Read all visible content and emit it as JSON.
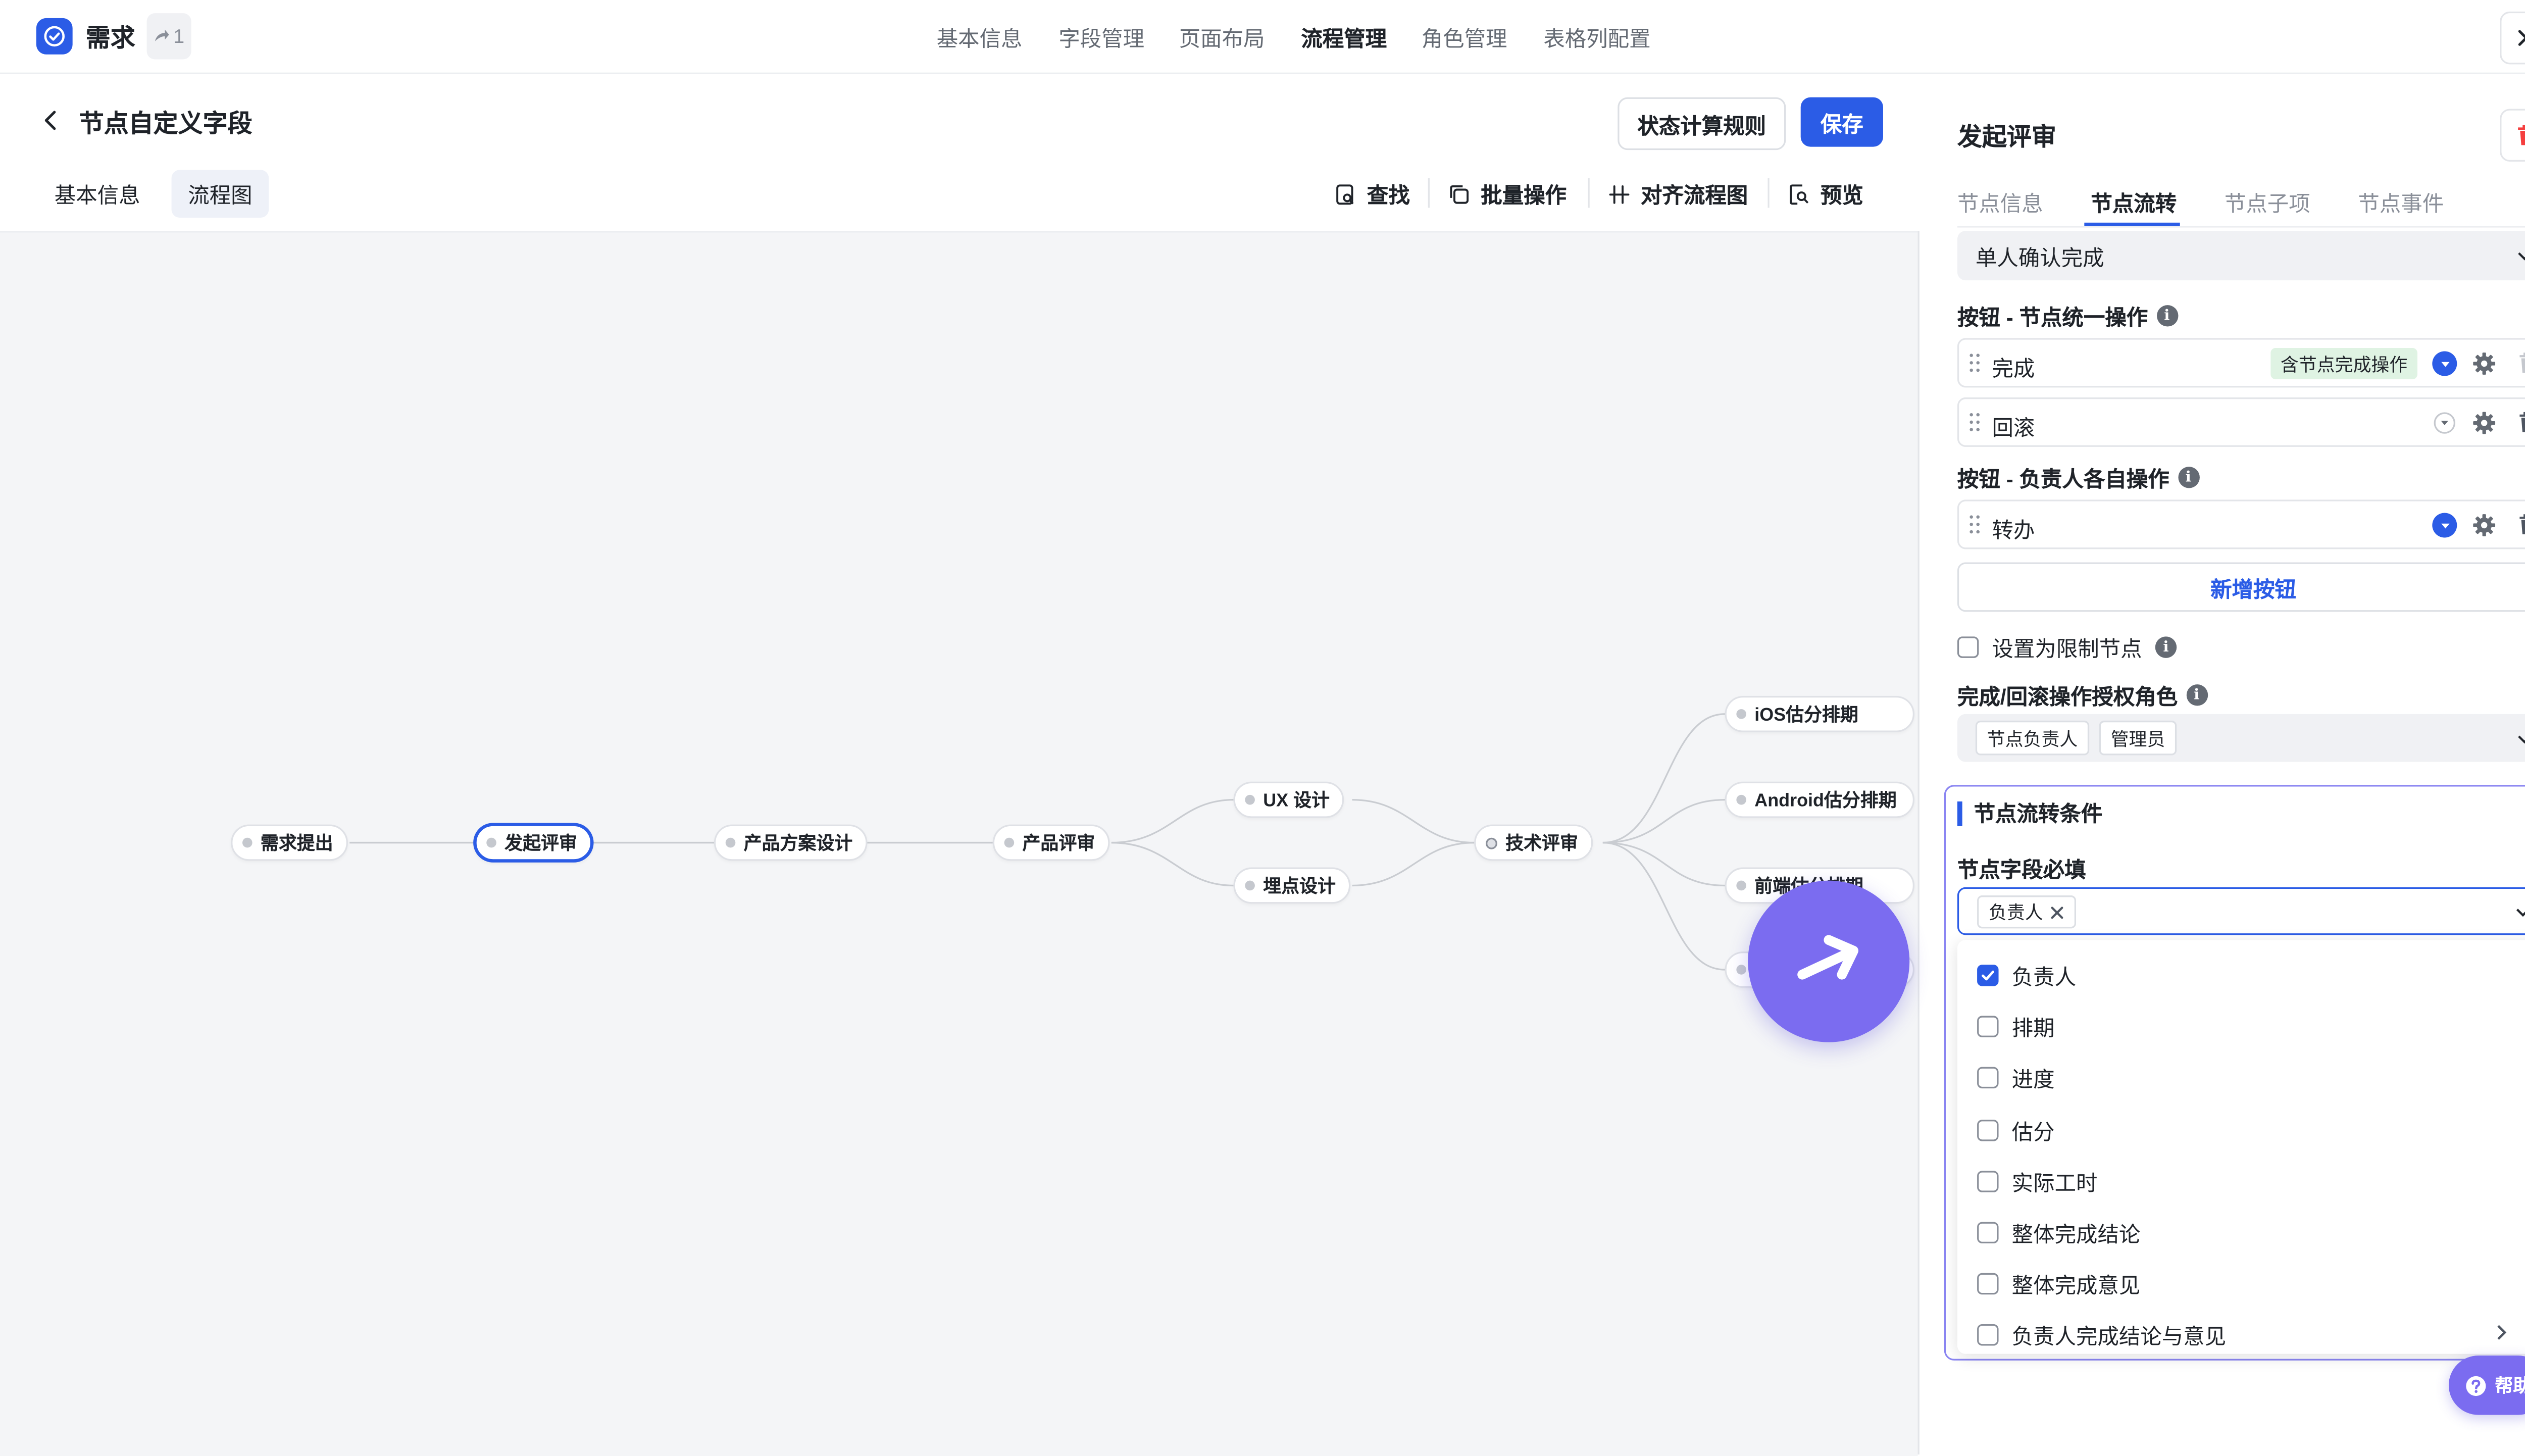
{
  "app": {
    "title": "需求",
    "badge_count": "1"
  },
  "nav": [
    "基本信息",
    "字段管理",
    "页面布局",
    "流程管理",
    "角色管理",
    "表格列配置"
  ],
  "nav_active": "流程管理",
  "page": {
    "title": "节点自定义字段",
    "btn_rule": "状态计算规则",
    "btn_save": "保存",
    "subtabs": [
      "基本信息",
      "流程图"
    ],
    "tools": {
      "find": "查找",
      "batch": "批量操作",
      "align": "对齐流程图",
      "preview": "预览"
    }
  },
  "flow": {
    "nodes": {
      "n1": "需求提出",
      "n2": "发起评审",
      "n3": "产品方案设计",
      "n4": "产品评审",
      "n5": "UX 设计",
      "n6": "埋点设计",
      "n7": "技术评审",
      "n8": "iOS估分排期",
      "n9": "Android估分排期",
      "n10": "前端估分排期"
    }
  },
  "panel": {
    "title": "发起评审",
    "tabs": [
      "节点信息",
      "节点流转",
      "节点子项",
      "节点事件"
    ],
    "complete_mode": "单人确认完成",
    "sec_unified": "按钮 - 节点统一操作",
    "buttons_unified": [
      {
        "label": "完成",
        "tag": "含节点完成操作"
      },
      {
        "label": "回滚"
      }
    ],
    "sec_individual": "按钮 - 负责人各自操作",
    "buttons_individual": [
      {
        "label": "转办"
      }
    ],
    "add_button": "新增按钮",
    "restrict_label": "设置为限制节点",
    "roles_label": "完成/回滚操作授权角色",
    "roles": [
      "节点负责人",
      "管理员"
    ],
    "cond_title": "节点流转条件",
    "required_label": "节点字段必填",
    "selected_tag": "负责人",
    "options": [
      "负责人",
      "排期",
      "进度",
      "估分",
      "实际工时",
      "整体完成结论",
      "整体完成意见",
      "负责人完成结论与意见"
    ],
    "checked_option": "负责人"
  },
  "help": "帮助",
  "colors": {
    "accent": "#2b5ce6",
    "fab": "#7b6cf0",
    "tag_green": "#dff3e3",
    "danger": "#f53f3f"
  }
}
